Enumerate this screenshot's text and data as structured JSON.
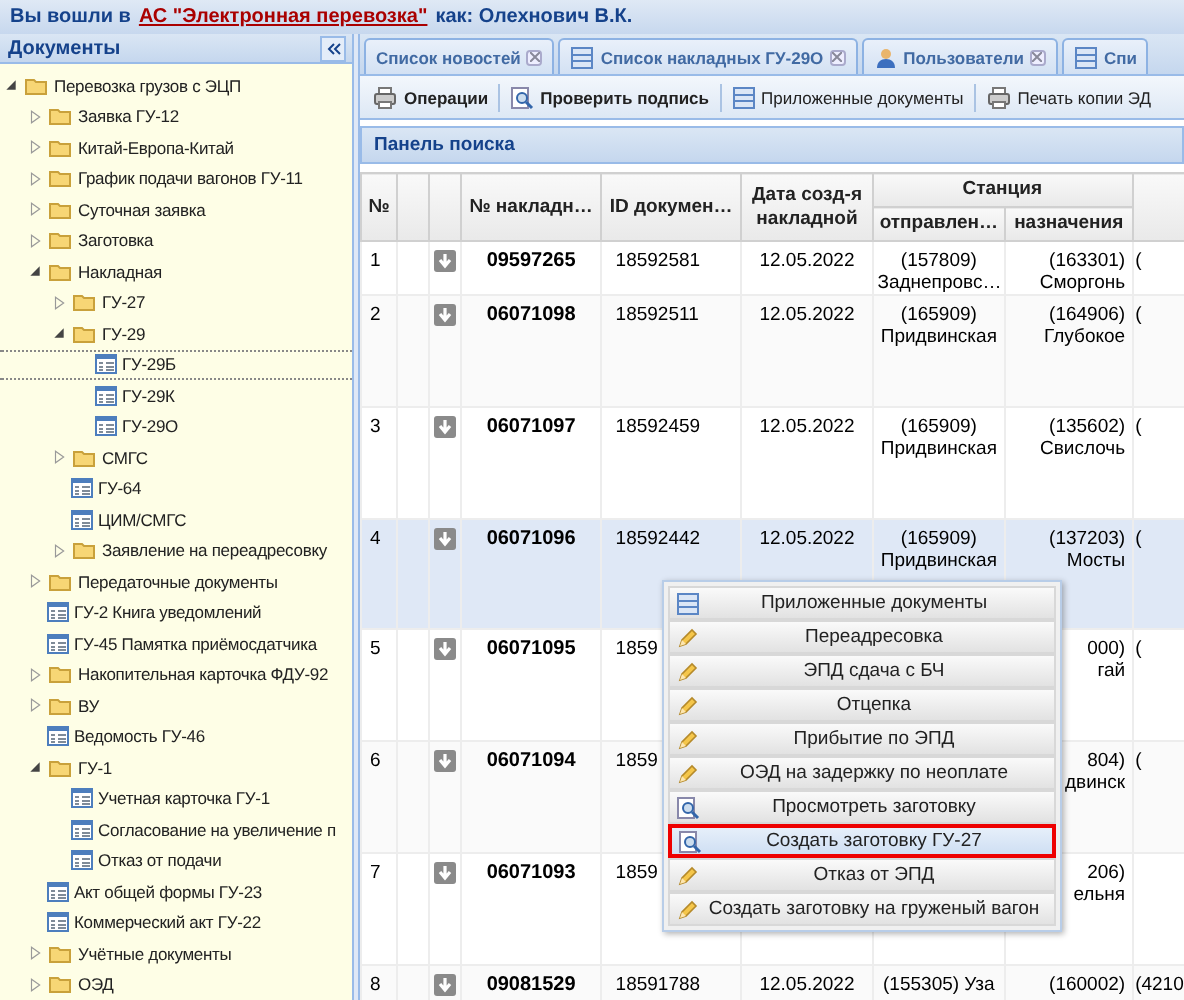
{
  "header": {
    "prefix": "Вы вошли в",
    "link": "АС \"Электронная перевозка\"",
    "suffix": "как: Олехнович В.К."
  },
  "sidebar": {
    "title": "Документы",
    "tree": [
      {
        "label": "Перевозка грузов с ЭЦП",
        "kind": "folder",
        "expanded": true,
        "children": [
          {
            "label": "Заявка ГУ-12",
            "kind": "folder",
            "expanded": false
          },
          {
            "label": "Китай-Европа-Китай",
            "kind": "folder",
            "expanded": false
          },
          {
            "label": "График подачи вагонов ГУ-11",
            "kind": "folder",
            "expanded": false
          },
          {
            "label": "Суточная заявка",
            "kind": "folder",
            "expanded": false
          },
          {
            "label": "Заготовка",
            "kind": "folder",
            "expanded": false
          },
          {
            "label": "Накладная",
            "kind": "folder",
            "expanded": true,
            "children": [
              {
                "label": "ГУ-27",
                "kind": "folder",
                "expanded": false
              },
              {
                "label": "ГУ-29",
                "kind": "folder",
                "expanded": true,
                "children": [
                  {
                    "label": "ГУ-29Б",
                    "kind": "doc",
                    "selected": true
                  },
                  {
                    "label": "ГУ-29К",
                    "kind": "doc",
                    "selected": false
                  },
                  {
                    "label": "ГУ-29О",
                    "kind": "doc",
                    "selected": false
                  }
                ]
              },
              {
                "label": "СМГС",
                "kind": "folder",
                "expanded": false
              },
              {
                "label": "ГУ-64",
                "kind": "doc",
                "selected": false
              },
              {
                "label": "ЦИМ/СМГС",
                "kind": "doc",
                "selected": false
              },
              {
                "label": "Заявление на переадресовку",
                "kind": "folder",
                "expanded": false
              }
            ]
          },
          {
            "label": "Передаточные документы",
            "kind": "folder",
            "expanded": false
          },
          {
            "label": "ГУ-2 Книга уведомлений",
            "kind": "doc",
            "selected": false
          },
          {
            "label": "ГУ-45 Памятка приёмосдатчика",
            "kind": "doc",
            "selected": false
          },
          {
            "label": "Накопительная карточка ФДУ-92",
            "kind": "folder",
            "expanded": false
          },
          {
            "label": "ВУ",
            "kind": "folder",
            "expanded": false
          },
          {
            "label": "Ведомость ГУ-46",
            "kind": "doc",
            "selected": false
          },
          {
            "label": "ГУ-1",
            "kind": "folder",
            "expanded": true,
            "children": [
              {
                "label": "Учетная карточка ГУ-1",
                "kind": "doc",
                "selected": false
              },
              {
                "label": "Согласование на увеличение п",
                "kind": "doc",
                "selected": false
              },
              {
                "label": "Отказ от подачи",
                "kind": "doc",
                "selected": false
              }
            ]
          },
          {
            "label": "Акт общей формы ГУ-23",
            "kind": "doc",
            "selected": false
          },
          {
            "label": "Коммерческий акт ГУ-22",
            "kind": "doc",
            "selected": false
          },
          {
            "label": "Учётные документы",
            "kind": "folder",
            "expanded": false
          },
          {
            "label": "ОЭД",
            "kind": "folder",
            "expanded": false
          }
        ]
      }
    ]
  },
  "tabs": [
    {
      "label": "Список новостей",
      "kind": "plain"
    },
    {
      "label": "Список накладных ГУ-29О",
      "kind": "list"
    },
    {
      "label": "Пользователи",
      "kind": "user"
    },
    {
      "label": "Спи",
      "kind": "list"
    }
  ],
  "toolbar": [
    {
      "label": "Операции",
      "kind": "print",
      "bold": true
    },
    {
      "label": "Проверить подпись",
      "kind": "check",
      "bold": true
    },
    {
      "label": "Приложенные документы",
      "kind": "list",
      "bold": false
    },
    {
      "label": "Печать копии ЭД",
      "kind": "print",
      "bold": false
    }
  ],
  "search_panel": {
    "title": "Панель поиска"
  },
  "table": {
    "header": {
      "num": "№",
      "waybill": "№ накладн…",
      "id": "ID докумен…",
      "date": "Дата созд-я накладной",
      "station": "Станция",
      "from": "отправлен…",
      "to": "назначения"
    },
    "rows": [
      {
        "num": "1",
        "waybill": "09597265",
        "id": "18592581",
        "date": "12.05.2022",
        "from": [
          "(157809)",
          "Заднепровс…"
        ],
        "to": [
          "(163301)",
          "Сморгонь"
        ],
        "column_9": "(",
        "selected": false
      },
      {
        "num": "2",
        "waybill": "06071098",
        "id": "18592511",
        "date": "12.05.2022",
        "from": [
          "(165909)",
          "Придвинская"
        ],
        "to": [
          "(164906)",
          "Глубокое"
        ],
        "column_9": "(",
        "selected": false
      },
      {
        "num": "3",
        "waybill": "06071097",
        "id": "18592459",
        "date": "12.05.2022",
        "from": [
          "(165909)",
          "Придвинская"
        ],
        "to": [
          "(135602)",
          "Свислочь"
        ],
        "column_9": "(",
        "selected": false
      },
      {
        "num": "4",
        "waybill": "06071096",
        "id": "18592442",
        "date": "12.05.2022",
        "from": [
          "(165909)",
          "Придвинская"
        ],
        "to": [
          "(137203)",
          "Мосты"
        ],
        "column_9": "(",
        "selected": true
      },
      {
        "num": "5",
        "waybill": "06071095",
        "id": "1859",
        "to": [
          "000)",
          "гай"
        ],
        "column_9": "(",
        "selected": false
      },
      {
        "num": "6",
        "waybill": "06071094",
        "id": "1859",
        "to": [
          "804)",
          "двинск"
        ],
        "column_9": "(",
        "selected": false
      },
      {
        "num": "7",
        "waybill": "06071093",
        "id": "1859",
        "to": [
          "206)",
          "ельня"
        ],
        "selected": false
      },
      {
        "num": "8",
        "waybill": "09081529",
        "id": "18591788",
        "date": "12.05.2022",
        "from": [
          "(155305) Уза"
        ],
        "to": [
          "(160002)"
        ],
        "column_9": "(4210",
        "selected": false
      }
    ]
  },
  "context_menu": [
    {
      "label": "Приложенные документы",
      "kind": "list",
      "selected": false
    },
    {
      "label": "Переадресовка",
      "kind": "edit",
      "selected": false
    },
    {
      "label": "ЭПД сдача с БЧ",
      "kind": "edit",
      "selected": false
    },
    {
      "label": "Отцепка",
      "kind": "edit",
      "selected": false
    },
    {
      "label": "Прибытие по ЭПД",
      "kind": "edit",
      "selected": false
    },
    {
      "label": "ОЭД на задержку по неоплате",
      "kind": "edit",
      "selected": false
    },
    {
      "label": "Просмотреть заготовку",
      "kind": "view",
      "selected": false
    },
    {
      "label": "Создать заготовку ГУ-27",
      "kind": "view",
      "selected": true
    },
    {
      "label": "Отказ от ЭПД",
      "kind": "edit",
      "selected": false
    },
    {
      "label": "Создать заготовку на груженый вагон",
      "kind": "edit",
      "selected": false
    }
  ]
}
